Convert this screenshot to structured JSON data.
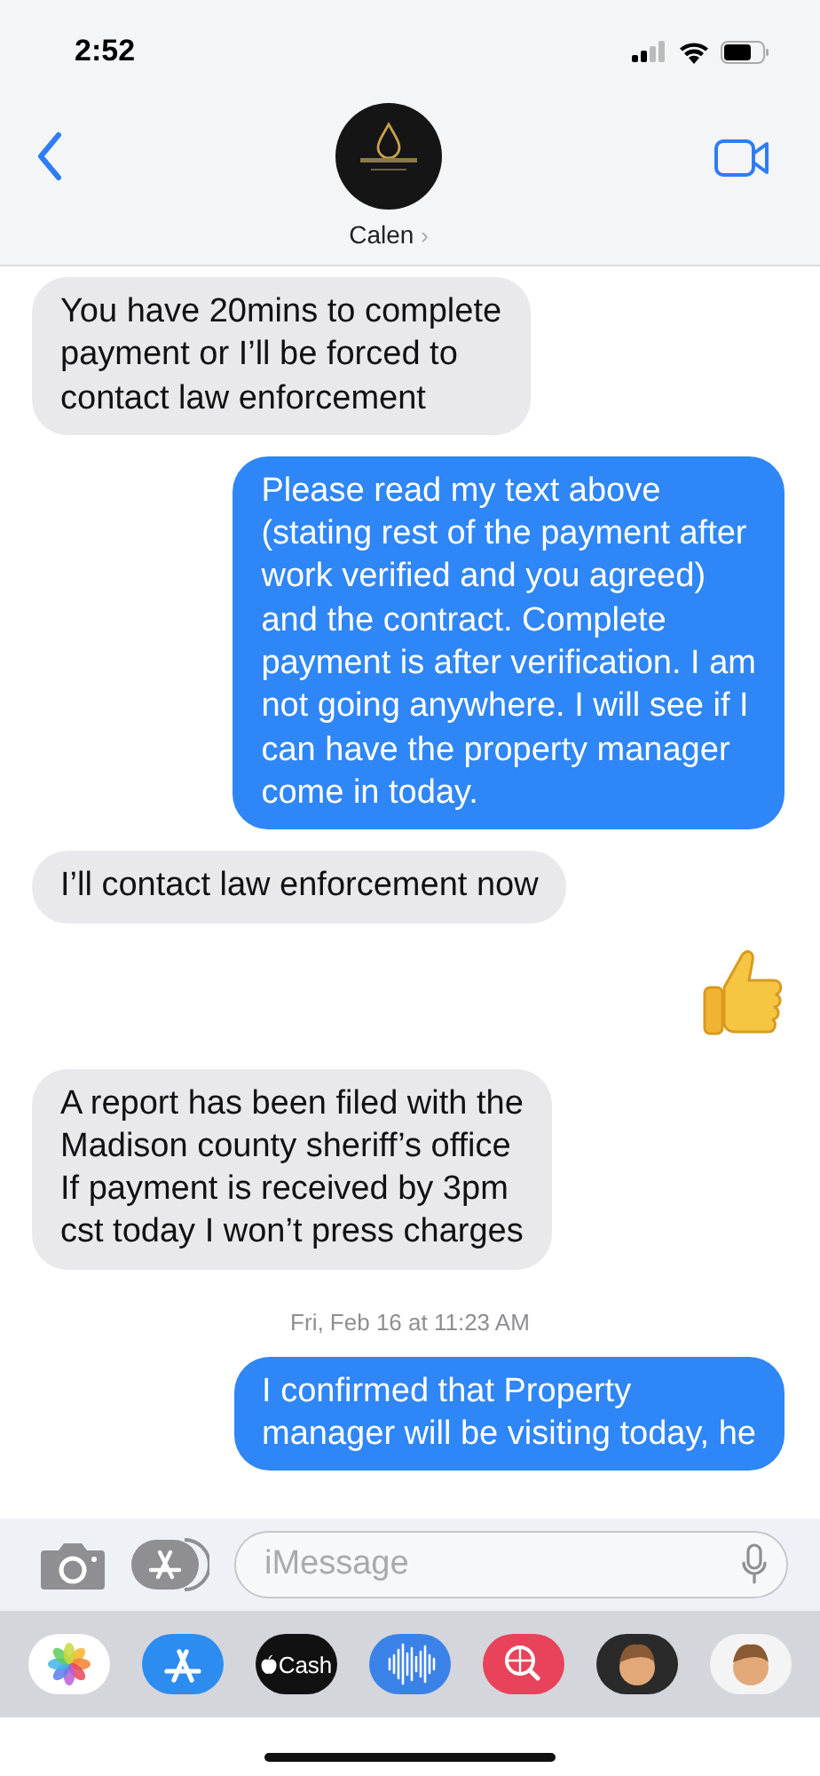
{
  "status_bar": {
    "time": "2:52"
  },
  "header": {
    "contact": "Calen",
    "chevron": "›"
  },
  "messages": [
    {
      "kind": "text",
      "outgoing": false,
      "text": "You have 20mins to complete\npayment or I’ll be forced to\ncontact law enforcement"
    },
    {
      "kind": "text",
      "outgoing": true,
      "text": "Please read my text above\n(stating rest of the payment after\nwork verified and you agreed)\nand the contract. Complete\npayment is after verification. I am\nnot going anywhere. I will see if I\ncan have the property manager\ncome in today."
    },
    {
      "kind": "text",
      "outgoing": false,
      "text": "I’ll contact law enforcement now"
    },
    {
      "kind": "thumbs_up",
      "outgoing": true
    },
    {
      "kind": "text",
      "outgoing": false,
      "text": "A report has been filed with the\nMadison county sheriff’s office\nIf payment is received by 3pm\ncst today I won’t press charges"
    },
    {
      "kind": "timestamp",
      "text": "Fri, Feb 16 at 11:23 AM"
    },
    {
      "kind": "text",
      "outgoing": true,
      "text": "I confirmed that Property\nmanager will be visiting today, he"
    }
  ],
  "composer": {
    "placeholder": "iMessage"
  },
  "app_drawer": [
    {
      "kind": "photos"
    },
    {
      "kind": "appstore"
    },
    {
      "kind": "cash",
      "label": "Cash"
    },
    {
      "kind": "audio"
    },
    {
      "kind": "search"
    },
    {
      "kind": "memoji"
    },
    {
      "kind": "memoji"
    }
  ]
}
